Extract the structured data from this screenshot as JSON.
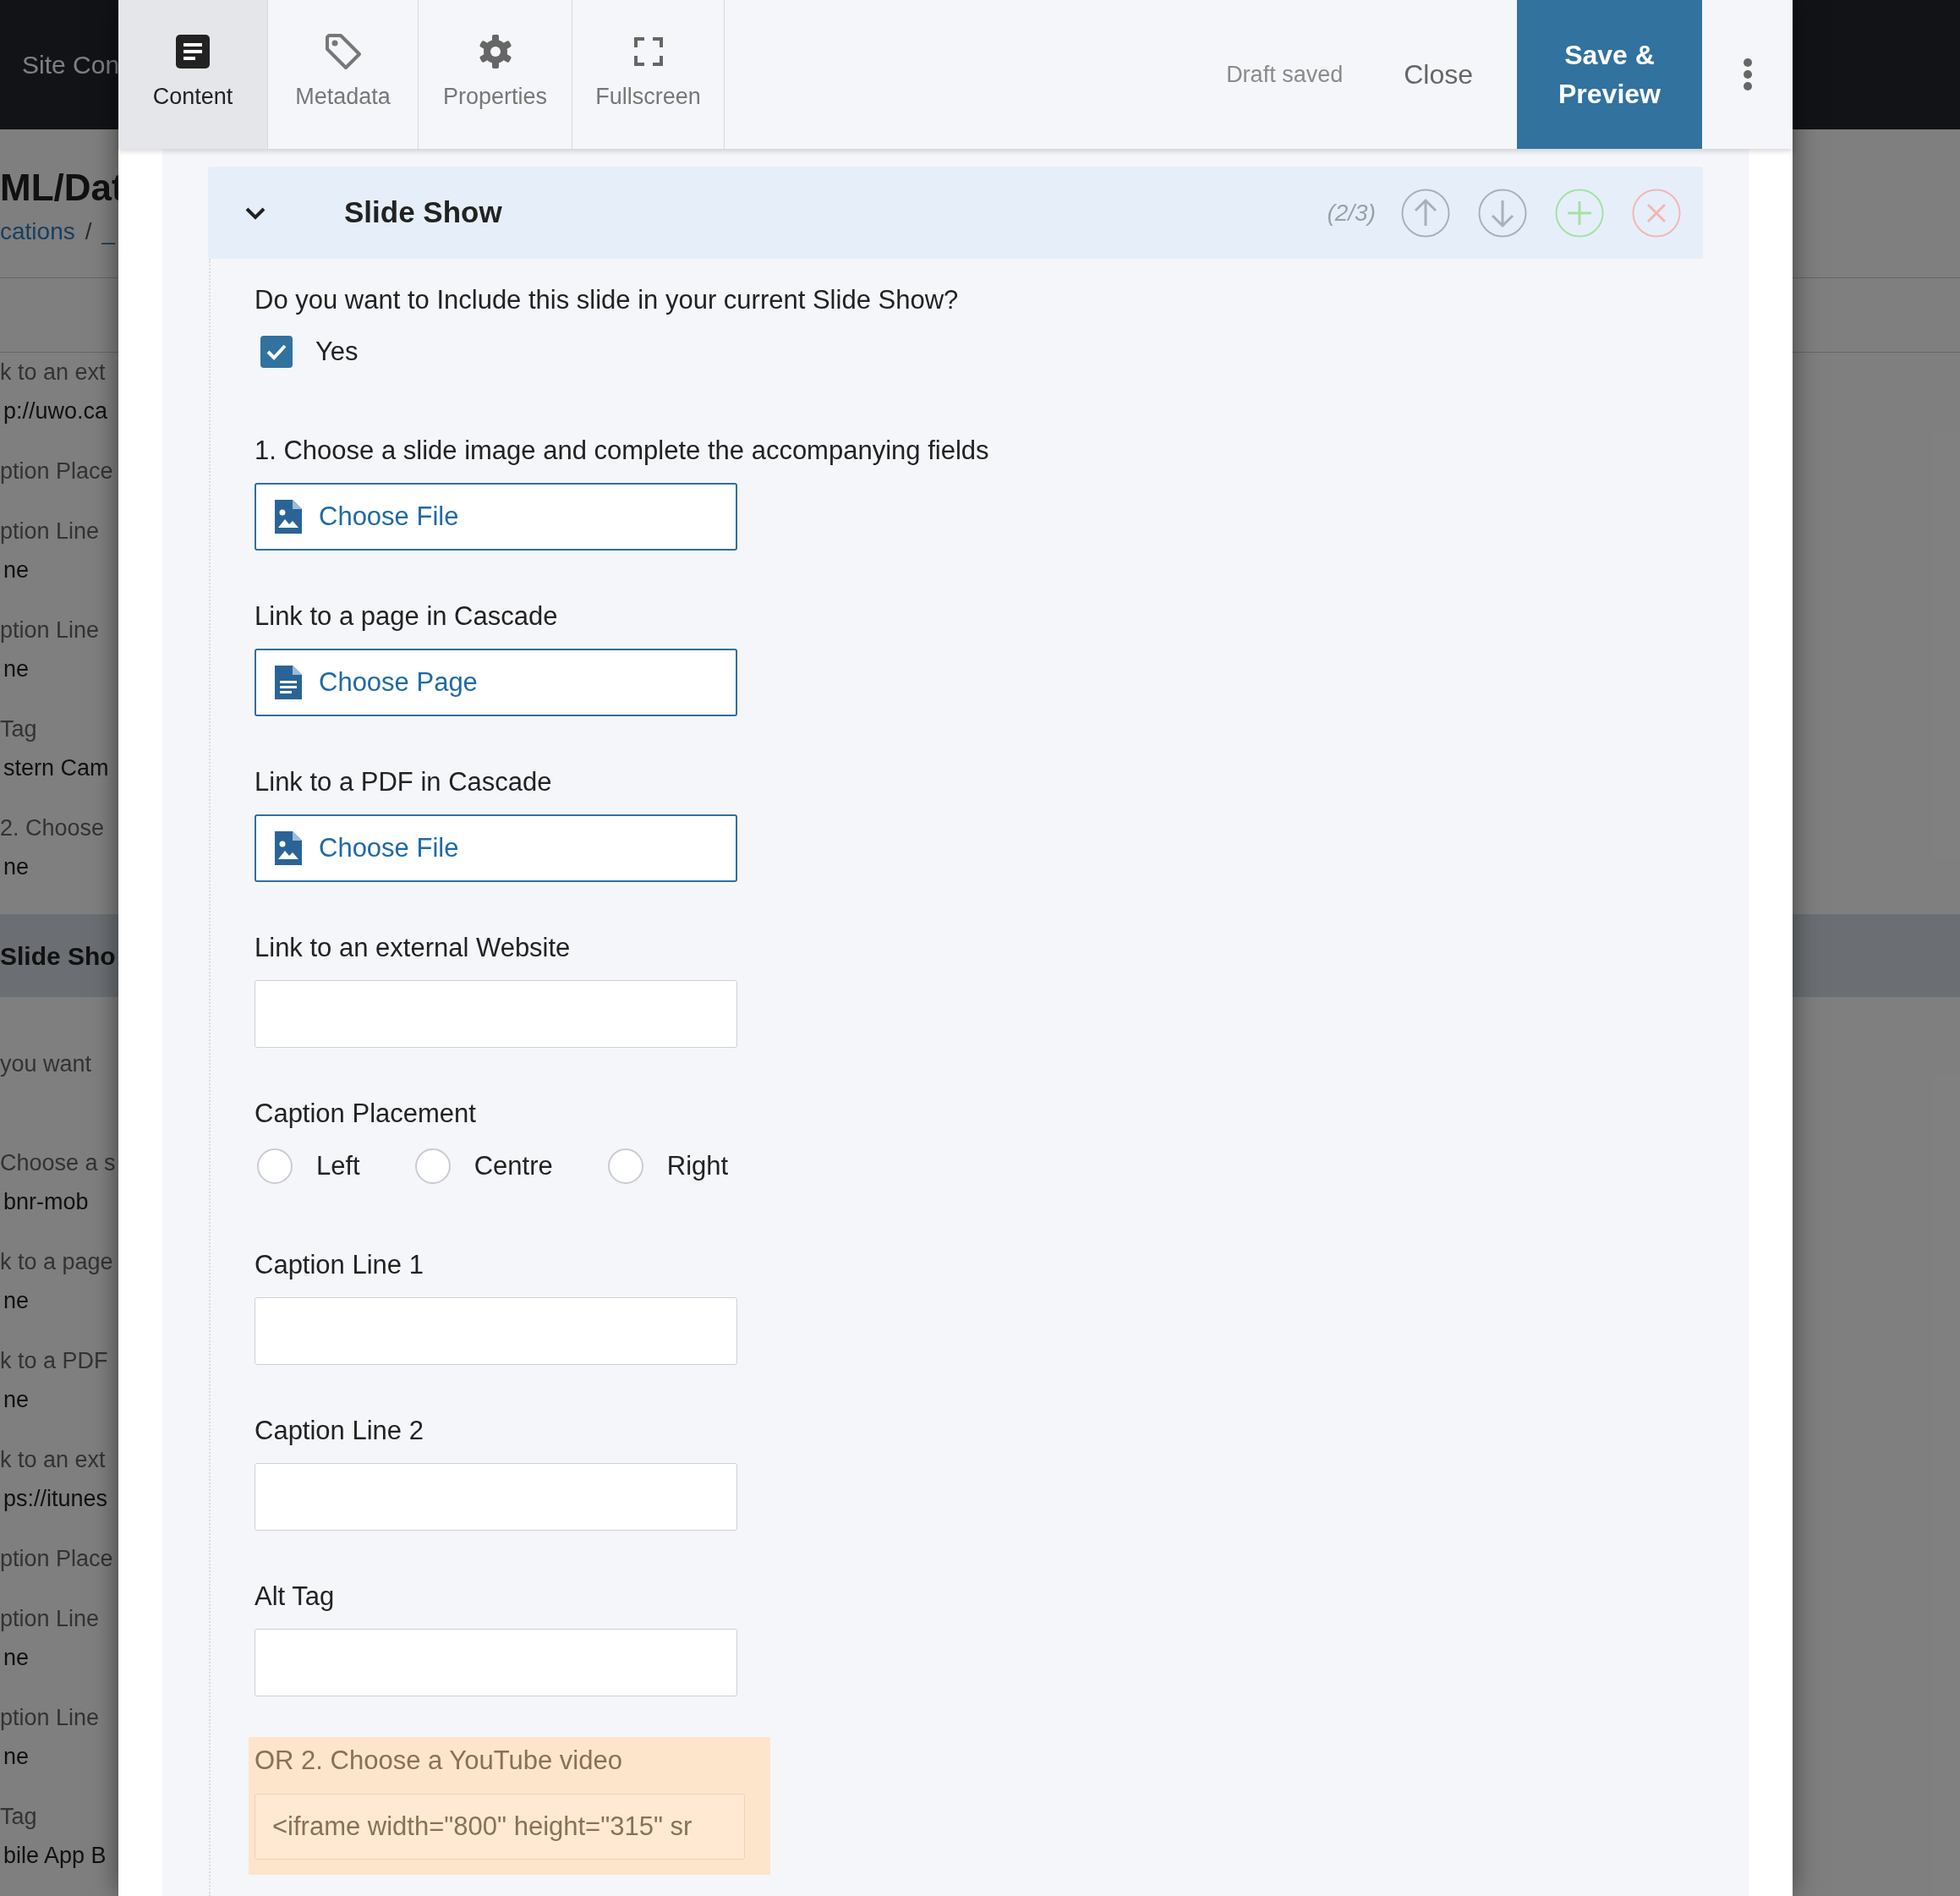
{
  "background_page": {
    "header_title": "Site Con",
    "page_title": "ML/Dat",
    "breadcrumb": [
      {
        "text": "cations",
        "kind": "link"
      },
      {
        "text": "/",
        "kind": "separator"
      },
      {
        "text": "_",
        "kind": "link"
      }
    ],
    "groups_before": [
      {
        "label": "k to an ext",
        "value": "p://uwo.ca"
      },
      {
        "label": "ption Place"
      },
      {
        "label": "ption Line",
        "value": "ne"
      },
      {
        "label": "ption Line",
        "value": "ne"
      },
      {
        "label": "Tag",
        "value": "stern Cam"
      },
      {
        "label": "2. Choose",
        "value": "ne"
      }
    ],
    "section_title": "Slide Sho",
    "groups_after": [
      {
        "label": "you want"
      },
      {
        "label": "Choose a s",
        "value": "bnr-mob"
      },
      {
        "label": "k to a page",
        "value": "ne"
      },
      {
        "label": "k to a PDF",
        "value": "ne"
      },
      {
        "label": "k to an ext",
        "value": "ps://itunes"
      },
      {
        "label": "ption Place"
      },
      {
        "label": "ption Line",
        "value": "ne"
      },
      {
        "label": "ption Line",
        "value": "ne"
      },
      {
        "label": "Tag",
        "value": "bile App B"
      }
    ]
  },
  "toolbar": {
    "tabs": [
      {
        "label": "Content",
        "selected": true
      },
      {
        "label": "Metadata",
        "selected": false
      },
      {
        "label": "Properties",
        "selected": false
      },
      {
        "label": "Fullscreen",
        "selected": false
      }
    ],
    "status": "Draft saved",
    "close": "Close",
    "save": "Save & Preview"
  },
  "section": {
    "title": "Slide Show",
    "expanded": true,
    "position": "(2/3)"
  },
  "question": "Do you want to Include this slide in your current Slide Show?",
  "include_checkbox": {
    "label": "Yes",
    "checked": true
  },
  "fields": [
    {
      "kind": "file",
      "label": "1. Choose a slide image and complete the accompanying fields",
      "button": "Choose File"
    },
    {
      "kind": "page",
      "label": "Link to a page in Cascade",
      "button": "Choose Page"
    },
    {
      "kind": "file",
      "label": "Link to a PDF in Cascade",
      "button": "Choose File"
    },
    {
      "kind": "text",
      "label": "Link to an external Website"
    },
    {
      "kind": "radio",
      "label": "Caption Placement",
      "options": [
        {
          "label": "Left",
          "selected": false
        },
        {
          "label": "Centre",
          "selected": false
        },
        {
          "label": "Right",
          "selected": false
        }
      ]
    },
    {
      "kind": "text",
      "label": "Caption Line 1"
    },
    {
      "kind": "text",
      "label": "Caption Line 2"
    },
    {
      "kind": "text",
      "label": "Alt Tag"
    },
    {
      "kind": "embed",
      "label": "OR 2. Choose a YouTube video",
      "value": "<iframe width=\"800\" height=\"315\" sr"
    }
  ]
}
